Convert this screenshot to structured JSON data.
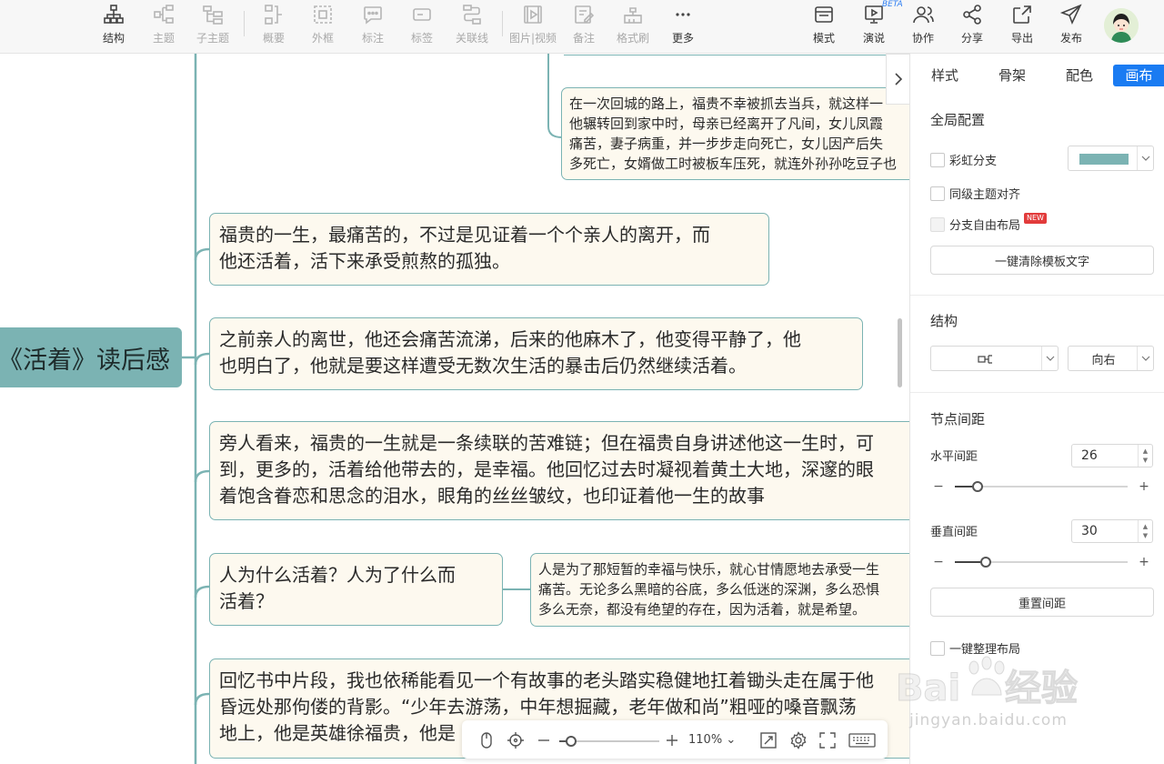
{
  "toolbar": {
    "items": [
      {
        "label": "结构",
        "icon": "structure-icon"
      },
      {
        "label": "主题",
        "icon": "topic-icon"
      },
      {
        "label": "子主题",
        "icon": "subtopic-icon"
      },
      {
        "label": "概要",
        "icon": "summary-icon"
      },
      {
        "label": "外框",
        "icon": "frame-icon"
      },
      {
        "label": "标注",
        "icon": "callout-icon"
      },
      {
        "label": "标签",
        "icon": "tag-icon"
      },
      {
        "label": "关联线",
        "icon": "relation-line-icon"
      },
      {
        "label": "图片|视频",
        "icon": "image-video-icon"
      },
      {
        "label": "备注",
        "icon": "note-icon"
      },
      {
        "label": "格式刷",
        "icon": "format-brush-icon"
      },
      {
        "label": "更多",
        "icon": "more-icon"
      },
      {
        "label": "模式",
        "icon": "mode-icon"
      },
      {
        "label": "演说",
        "icon": "present-icon"
      },
      {
        "label": "协作",
        "icon": "collaborate-icon"
      },
      {
        "label": "分享",
        "icon": "share-icon"
      },
      {
        "label": "导出",
        "icon": "export-icon"
      },
      {
        "label": "发布",
        "icon": "publish-icon"
      }
    ],
    "beta": "BETA"
  },
  "mindmap": {
    "root": "《活着》读后感",
    "nodes": [
      {
        "lines": [
          "在一次回城的路上，福贵不幸被抓去当兵，就这样一",
          "他辗转回到家中时，母亲已经离开了凡间，女儿凤霞",
          "痛苦，妻子病重，并一步步走向死亡，女儿因产后失",
          "多死亡，女婿做工时被板车压死，就连外孙孙吃豆子也"
        ]
      },
      {
        "lines": [
          "福贵的一生，最痛苦的，不过是见证着一个个亲人的离开，而",
          "他还活着，活下来承受煎熬的孤独。"
        ]
      },
      {
        "lines": [
          "之前亲人的离世，他还会痛苦流涕，后来的他麻木了，他变得平静了，他",
          "也明白了，他就是要这样遭受无数次生活的暴击后仍然继续活着。"
        ]
      },
      {
        "lines": [
          "旁人看来，福贵的一生就是一条续联的苦难链；但在福贵自身讲述他这一生时，可",
          "到，更多的，活着给他带去的，是幸福。他回忆过去时凝视着黄土大地，深邃的眼",
          "着饱含眷恋和思念的泪水，眼角的丝丝皱纹，也印证着他一生的故事"
        ]
      },
      {
        "lines": [
          "人为什么活着？人为了什么而",
          "活着？"
        ]
      },
      {
        "lines": [
          "人是为了那短暂的幸福与快乐，就心甘情愿地去承受一生",
          "痛苦。无论多么黑暗的谷底，多么低迷的深渊，多么恐惧",
          "多么无奈，都没有绝望的存在，因为活着，就是希望。"
        ]
      },
      {
        "lines": [
          "回忆书中片段，我也依稀能看见一个有故事的老头踏实稳健地扛着锄头走在属于他",
          "昏远处那佝偻的背影。“少年去游荡，中年想掘藏，老年做和尚”粗哑的嗓音飘荡",
          "地上，他是英雄徐福贵，他是"
        ]
      }
    ]
  },
  "bottombar": {
    "zoom": "110%",
    "zoom_fraction": 0.12,
    "icons": [
      "mouse-icon",
      "locate-icon",
      "zoom-out-icon",
      "zoom-in-icon",
      "fit-screen-icon",
      "settings-icon",
      "fullscreen-icon",
      "keyboard-icon"
    ]
  },
  "panel": {
    "tabs": [
      {
        "label": "样式",
        "active": false
      },
      {
        "label": "骨架",
        "active": false
      },
      {
        "label": "配色",
        "active": false
      },
      {
        "label": "画布",
        "active": true
      }
    ],
    "global_config": {
      "title": "全局配置",
      "rainbow_branch": "彩虹分支",
      "rainbow_color": "#7bb3b3",
      "same_level_align": "同级主题对齐",
      "free_layout": "分支自由布局",
      "new_badge": "NEW",
      "clear_template_btn": "一键清除模板文字"
    },
    "structure": {
      "title": "结构",
      "direction": "向右"
    },
    "spacing": {
      "title": "节点间距",
      "horizontal_label": "水平间距",
      "horizontal_value": "26",
      "horizontal_fraction": 0.13,
      "vertical_label": "垂直间距",
      "vertical_value": "30",
      "vertical_fraction": 0.18,
      "reset_btn": "重置间距"
    },
    "tidy_layout": "一键整理布局"
  },
  "watermark": {
    "brand": "Bai du 经验",
    "url": "jingyan.baidu.com"
  }
}
